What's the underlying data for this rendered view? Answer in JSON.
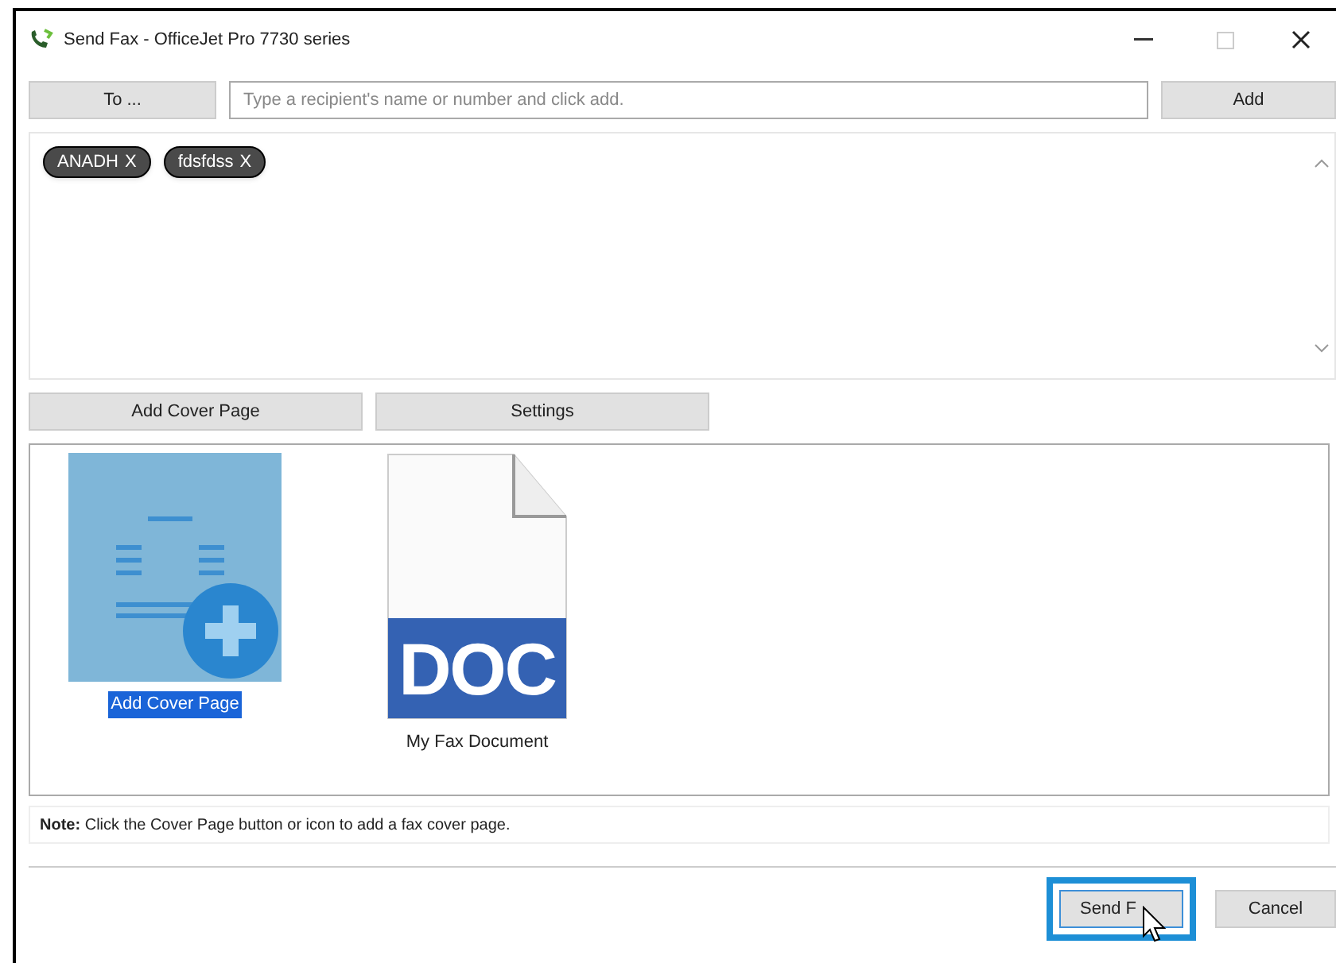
{
  "window": {
    "title": "Send Fax - OfficeJet Pro 7730 series"
  },
  "to_button": "To ...",
  "recipient_field": {
    "placeholder": "Type a recipient's name or number and click add."
  },
  "add_button": "Add",
  "recipients": [
    {
      "name": "ANADH",
      "remove": "X"
    },
    {
      "name": "fdsfdss",
      "remove": "X"
    }
  ],
  "actions": [
    "Add Cover Page",
    "Settings"
  ],
  "documents": [
    {
      "kind": "cover",
      "label": "Add Cover Page",
      "selected": true
    },
    {
      "kind": "doc",
      "label": "My Fax Document",
      "badge": "DOC",
      "selected": false
    }
  ],
  "note": "**Note:** Click the Cover Page button or icon to add a fax cover page.",
  "footer": {
    "send": {
      "label": "Send F",
      "focused": true
    },
    "cancel": "Cancel"
  }
}
